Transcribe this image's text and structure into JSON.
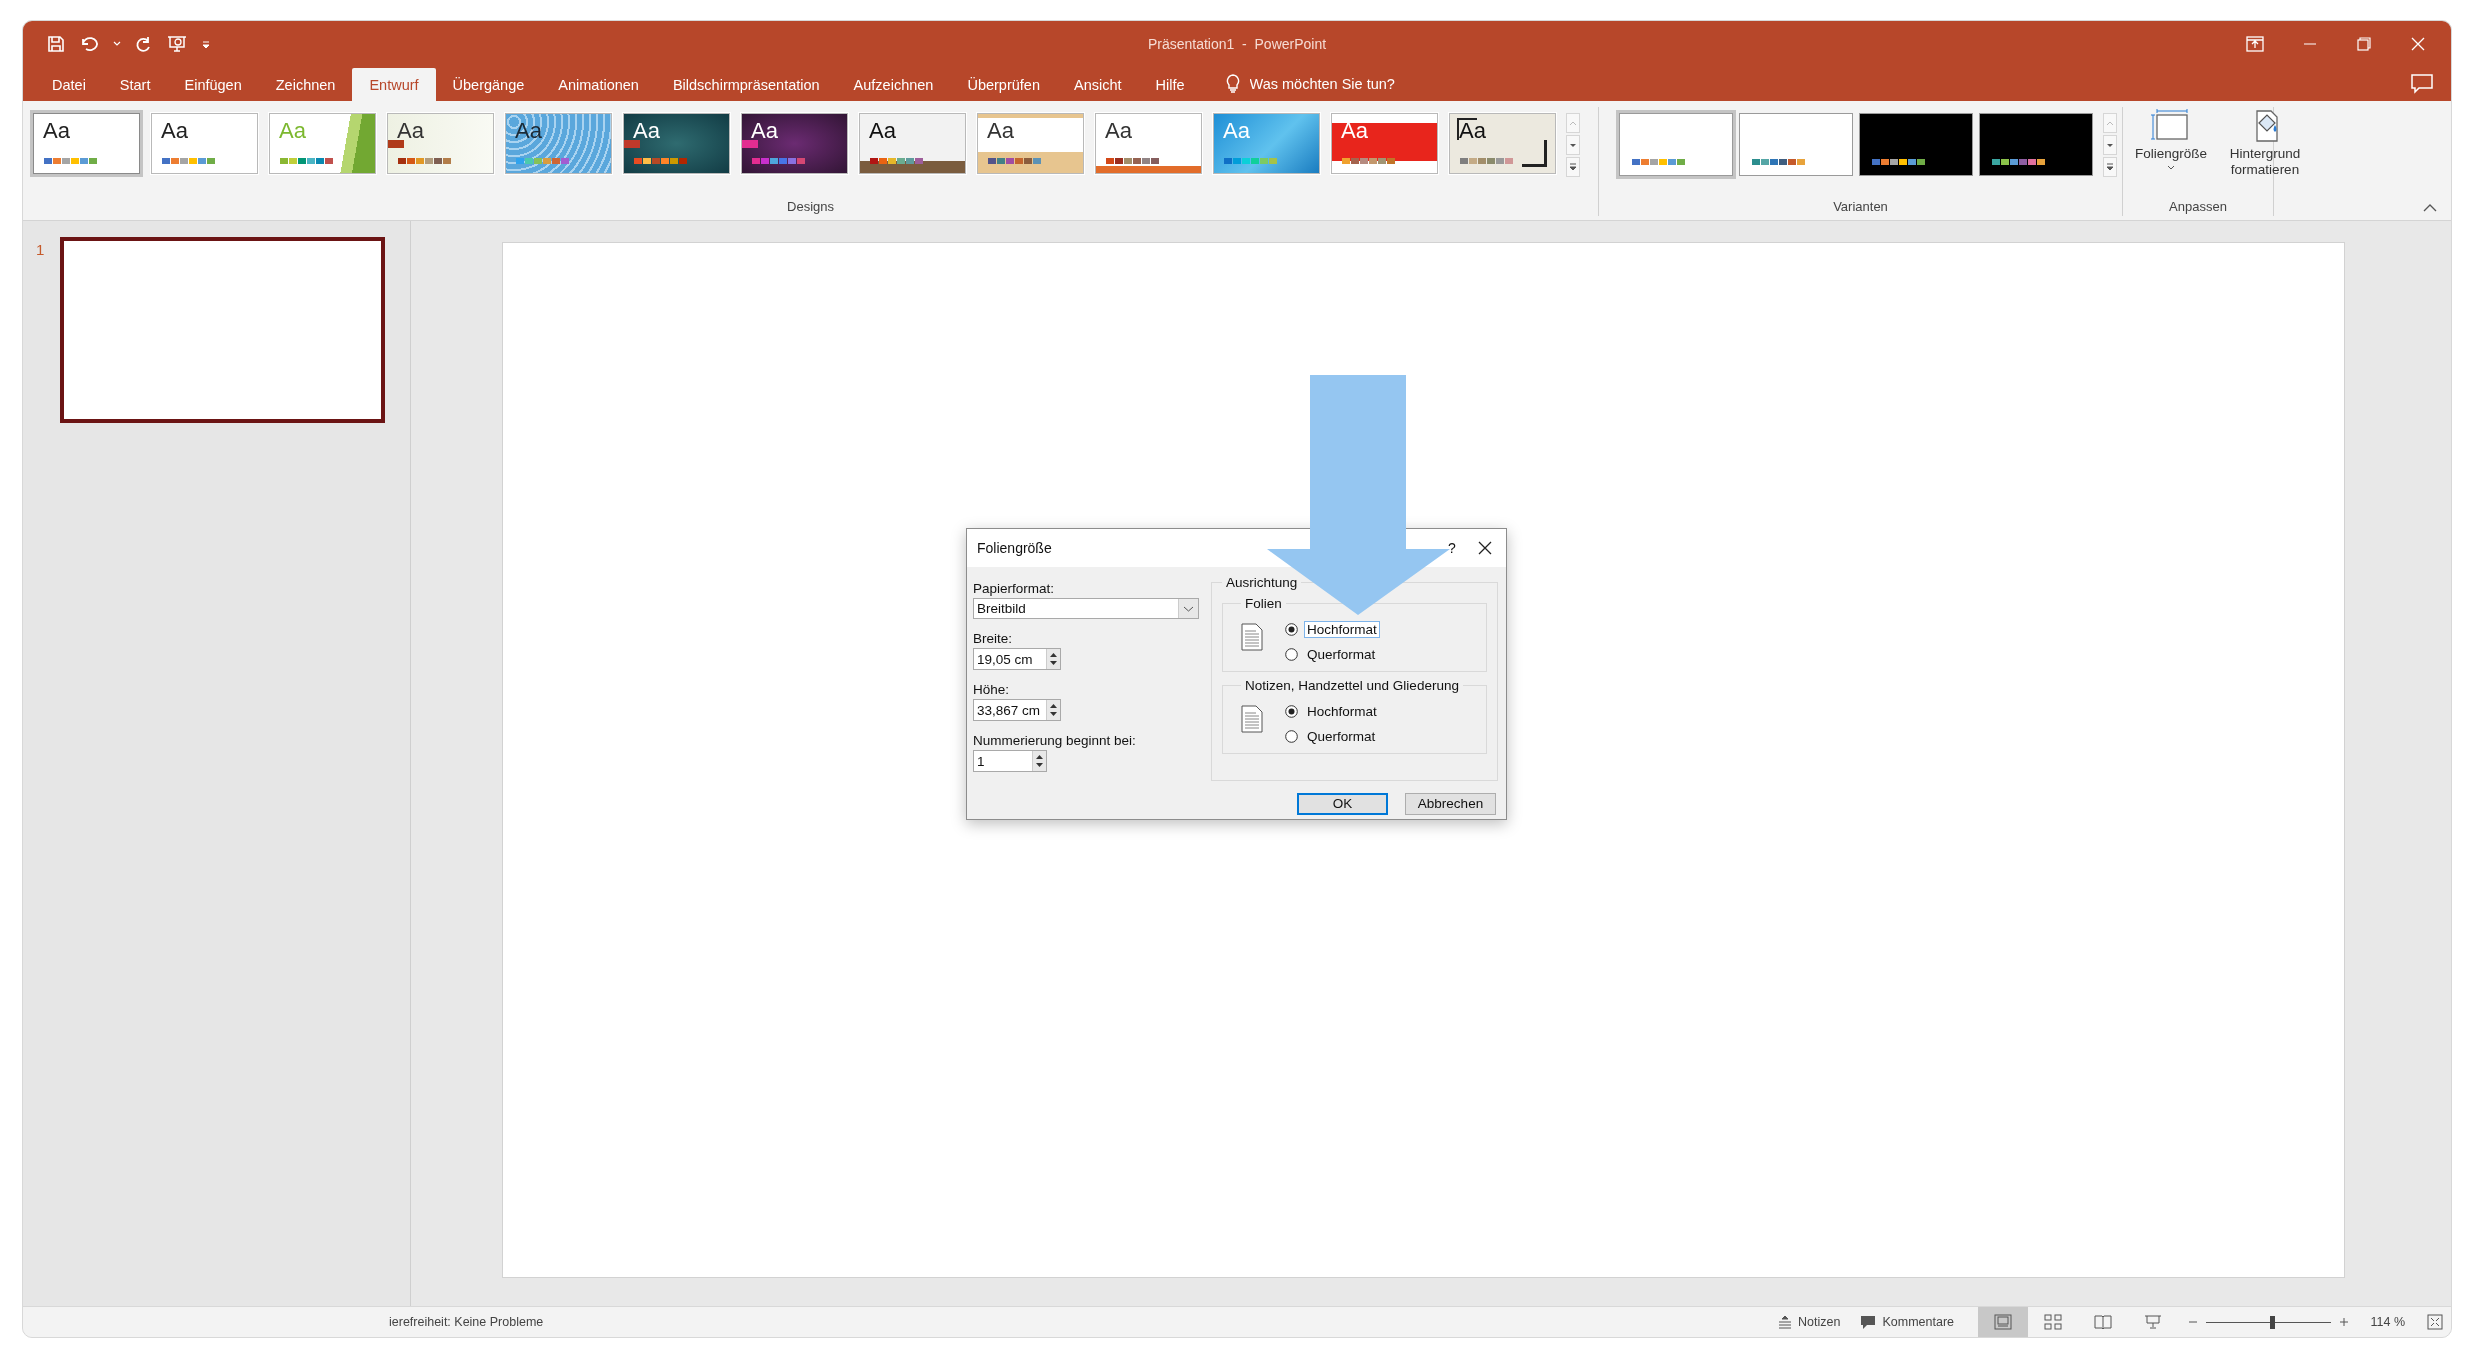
{
  "window": {
    "title": "Präsentation1  -  PowerPoint"
  },
  "ribbon_tabs": [
    {
      "label": "Datei",
      "selected": false
    },
    {
      "label": "Start",
      "selected": false
    },
    {
      "label": "Einfügen",
      "selected": false
    },
    {
      "label": "Zeichnen",
      "selected": false
    },
    {
      "label": "Entwurf",
      "selected": true
    },
    {
      "label": "Übergänge",
      "selected": false
    },
    {
      "label": "Animationen",
      "selected": false
    },
    {
      "label": "Bildschirmpräsentation",
      "selected": false
    },
    {
      "label": "Aufzeichnen",
      "selected": false
    },
    {
      "label": "Überprüfen",
      "selected": false
    },
    {
      "label": "Ansicht",
      "selected": false
    },
    {
      "label": "Hilfe",
      "selected": false
    }
  ],
  "tell_me": {
    "placeholder": "Was möchten Sie tun?"
  },
  "designs": {
    "label": "Designs",
    "themes": [
      {
        "label": "Aa",
        "selected": true
      },
      {
        "label": "Aa",
        "selected": false
      },
      {
        "label": "Aa",
        "selected": false
      },
      {
        "label": "Aa",
        "selected": false
      },
      {
        "label": "Aa",
        "selected": false
      },
      {
        "label": "Aa",
        "selected": false
      },
      {
        "label": "Aa",
        "selected": false
      },
      {
        "label": "Aa",
        "selected": false
      },
      {
        "label": "Aa",
        "selected": false
      },
      {
        "label": "Aa",
        "selected": false
      },
      {
        "label": "Aa",
        "selected": false
      },
      {
        "label": "Aa",
        "selected": false
      },
      {
        "label": "Aa",
        "selected": false
      }
    ]
  },
  "variants": {
    "label": "Varianten",
    "items": [
      {
        "kind": "light",
        "selected": true
      },
      {
        "kind": "light",
        "selected": false
      },
      {
        "kind": "dark",
        "selected": false
      },
      {
        "kind": "dark",
        "selected": false
      }
    ]
  },
  "customize": {
    "label": "Anpassen",
    "buttons": [
      "Foliengröße",
      "Hintergrund formatieren"
    ]
  },
  "slides": [
    {
      "number": "1",
      "selected": true
    }
  ],
  "dialog": {
    "title": "Foliengröße",
    "help": "?",
    "fields": [
      {
        "kind": "dropdown",
        "label": "Papierformat:",
        "value": "Breitbild"
      },
      {
        "kind": "spinner",
        "label": "Breite:",
        "value": "19,05 cm"
      },
      {
        "kind": "spinner",
        "label": "Höhe:",
        "value": "33,867 cm"
      },
      {
        "kind": "spinner",
        "label": "Nummerierung beginnt bei:",
        "value": "1"
      }
    ],
    "orientation": {
      "label": "Ausrichtung",
      "groups": [
        {
          "label": "Folien",
          "options": [
            {
              "label": "Hochformat",
              "selected": true,
              "focused": true
            },
            {
              "label": "Querformat",
              "selected": false,
              "focused": false
            }
          ]
        },
        {
          "label": "Notizen, Handzettel und Gliederung",
          "options": [
            {
              "label": "Hochformat",
              "selected": true,
              "focused": false
            },
            {
              "label": "Querformat",
              "selected": false,
              "focused": false
            }
          ]
        }
      ]
    },
    "buttons": [
      {
        "label": "OK",
        "default": true
      },
      {
        "label": "Abbrechen",
        "default": false
      }
    ]
  },
  "status_bar": {
    "accessibility": "ierefreiheit: Keine Probleme",
    "notes": "Notizen",
    "comments": "Kommentare",
    "views": [
      {
        "selected": true
      },
      {
        "selected": false
      },
      {
        "selected": false
      },
      {
        "selected": false
      }
    ],
    "zoom": {
      "level": 0.53,
      "reading": "114 %"
    }
  }
}
